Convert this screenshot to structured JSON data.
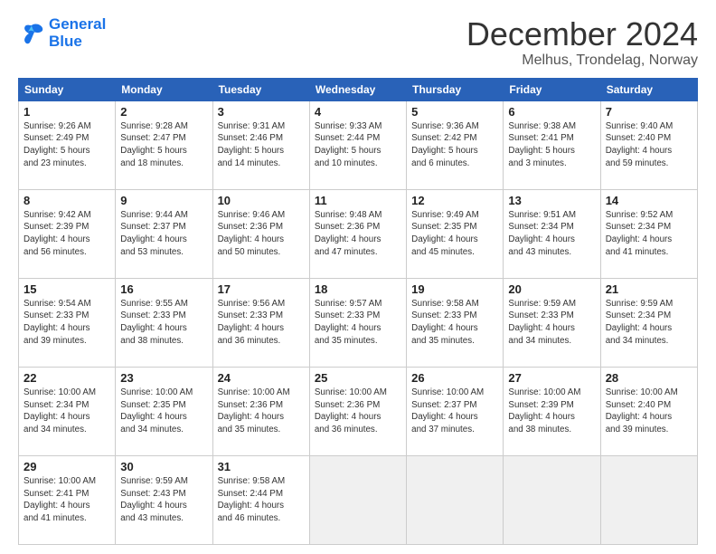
{
  "header": {
    "logo_line1": "General",
    "logo_line2": "Blue",
    "title": "December 2024",
    "subtitle": "Melhus, Trondelag, Norway"
  },
  "weekdays": [
    "Sunday",
    "Monday",
    "Tuesday",
    "Wednesday",
    "Thursday",
    "Friday",
    "Saturday"
  ],
  "weeks": [
    [
      {
        "day": "1",
        "info": "Sunrise: 9:26 AM\nSunset: 2:49 PM\nDaylight: 5 hours\nand 23 minutes."
      },
      {
        "day": "2",
        "info": "Sunrise: 9:28 AM\nSunset: 2:47 PM\nDaylight: 5 hours\nand 18 minutes."
      },
      {
        "day": "3",
        "info": "Sunrise: 9:31 AM\nSunset: 2:46 PM\nDaylight: 5 hours\nand 14 minutes."
      },
      {
        "day": "4",
        "info": "Sunrise: 9:33 AM\nSunset: 2:44 PM\nDaylight: 5 hours\nand 10 minutes."
      },
      {
        "day": "5",
        "info": "Sunrise: 9:36 AM\nSunset: 2:42 PM\nDaylight: 5 hours\nand 6 minutes."
      },
      {
        "day": "6",
        "info": "Sunrise: 9:38 AM\nSunset: 2:41 PM\nDaylight: 5 hours\nand 3 minutes."
      },
      {
        "day": "7",
        "info": "Sunrise: 9:40 AM\nSunset: 2:40 PM\nDaylight: 4 hours\nand 59 minutes."
      }
    ],
    [
      {
        "day": "8",
        "info": "Sunrise: 9:42 AM\nSunset: 2:39 PM\nDaylight: 4 hours\nand 56 minutes."
      },
      {
        "day": "9",
        "info": "Sunrise: 9:44 AM\nSunset: 2:37 PM\nDaylight: 4 hours\nand 53 minutes."
      },
      {
        "day": "10",
        "info": "Sunrise: 9:46 AM\nSunset: 2:36 PM\nDaylight: 4 hours\nand 50 minutes."
      },
      {
        "day": "11",
        "info": "Sunrise: 9:48 AM\nSunset: 2:36 PM\nDaylight: 4 hours\nand 47 minutes."
      },
      {
        "day": "12",
        "info": "Sunrise: 9:49 AM\nSunset: 2:35 PM\nDaylight: 4 hours\nand 45 minutes."
      },
      {
        "day": "13",
        "info": "Sunrise: 9:51 AM\nSunset: 2:34 PM\nDaylight: 4 hours\nand 43 minutes."
      },
      {
        "day": "14",
        "info": "Sunrise: 9:52 AM\nSunset: 2:34 PM\nDaylight: 4 hours\nand 41 minutes."
      }
    ],
    [
      {
        "day": "15",
        "info": "Sunrise: 9:54 AM\nSunset: 2:33 PM\nDaylight: 4 hours\nand 39 minutes."
      },
      {
        "day": "16",
        "info": "Sunrise: 9:55 AM\nSunset: 2:33 PM\nDaylight: 4 hours\nand 38 minutes."
      },
      {
        "day": "17",
        "info": "Sunrise: 9:56 AM\nSunset: 2:33 PM\nDaylight: 4 hours\nand 36 minutes."
      },
      {
        "day": "18",
        "info": "Sunrise: 9:57 AM\nSunset: 2:33 PM\nDaylight: 4 hours\nand 35 minutes."
      },
      {
        "day": "19",
        "info": "Sunrise: 9:58 AM\nSunset: 2:33 PM\nDaylight: 4 hours\nand 35 minutes."
      },
      {
        "day": "20",
        "info": "Sunrise: 9:59 AM\nSunset: 2:33 PM\nDaylight: 4 hours\nand 34 minutes."
      },
      {
        "day": "21",
        "info": "Sunrise: 9:59 AM\nSunset: 2:34 PM\nDaylight: 4 hours\nand 34 minutes."
      }
    ],
    [
      {
        "day": "22",
        "info": "Sunrise: 10:00 AM\nSunset: 2:34 PM\nDaylight: 4 hours\nand 34 minutes."
      },
      {
        "day": "23",
        "info": "Sunrise: 10:00 AM\nSunset: 2:35 PM\nDaylight: 4 hours\nand 34 minutes."
      },
      {
        "day": "24",
        "info": "Sunrise: 10:00 AM\nSunset: 2:36 PM\nDaylight: 4 hours\nand 35 minutes."
      },
      {
        "day": "25",
        "info": "Sunrise: 10:00 AM\nSunset: 2:36 PM\nDaylight: 4 hours\nand 36 minutes."
      },
      {
        "day": "26",
        "info": "Sunrise: 10:00 AM\nSunset: 2:37 PM\nDaylight: 4 hours\nand 37 minutes."
      },
      {
        "day": "27",
        "info": "Sunrise: 10:00 AM\nSunset: 2:39 PM\nDaylight: 4 hours\nand 38 minutes."
      },
      {
        "day": "28",
        "info": "Sunrise: 10:00 AM\nSunset: 2:40 PM\nDaylight: 4 hours\nand 39 minutes."
      }
    ],
    [
      {
        "day": "29",
        "info": "Sunrise: 10:00 AM\nSunset: 2:41 PM\nDaylight: 4 hours\nand 41 minutes."
      },
      {
        "day": "30",
        "info": "Sunrise: 9:59 AM\nSunset: 2:43 PM\nDaylight: 4 hours\nand 43 minutes."
      },
      {
        "day": "31",
        "info": "Sunrise: 9:58 AM\nSunset: 2:44 PM\nDaylight: 4 hours\nand 46 minutes."
      },
      {
        "day": "",
        "info": ""
      },
      {
        "day": "",
        "info": ""
      },
      {
        "day": "",
        "info": ""
      },
      {
        "day": "",
        "info": ""
      }
    ]
  ]
}
